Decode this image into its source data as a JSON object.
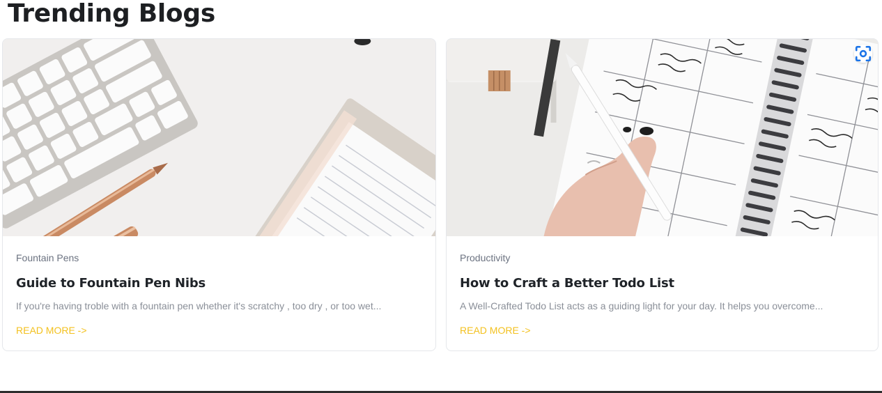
{
  "page": {
    "title": "Trending Blogs"
  },
  "cards": [
    {
      "image_alt": "keyboard-and-gold-pens",
      "category": "Fountain Pens",
      "title": "Guide to Fountain Pen Nibs",
      "excerpt": "If you're having troble with a fountain pen whether it's scratchy , too dry , or too wet...",
      "read_more": "READ MORE ->"
    },
    {
      "image_alt": "hand-writing-in-planner",
      "category": "Productivity",
      "title": "How to Craft a Better Todo List",
      "excerpt": "A Well-Crafted Todo List acts as a guiding light for your day. It helps you overcome...",
      "read_more": "READ MORE ->"
    }
  ],
  "icons": {
    "lens": "visual-search-icon"
  },
  "colors": {
    "accent": "#f3c11f",
    "category": "#6b7280",
    "excerpt": "#8a8f98"
  }
}
